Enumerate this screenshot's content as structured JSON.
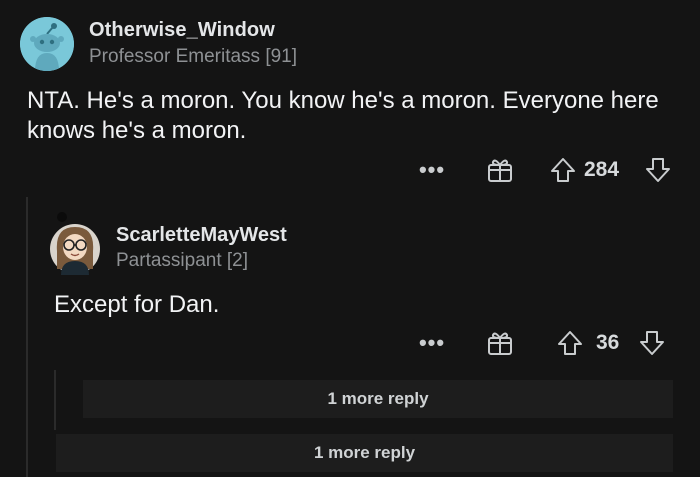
{
  "comment": {
    "author": "Otherwise_Window",
    "flair": "Professor Emeritass [91]",
    "body": "NTA. He's a moron. You know he's a moron. Everyone here knows he's a moron.",
    "more_icon": "ellipsis-icon",
    "award_icon": "gift-icon",
    "upvote_icon": "arrow-up-icon",
    "downvote_icon": "arrow-down-icon",
    "dots": "•••",
    "score": "284"
  },
  "reply": {
    "author": "ScarletteMayWest",
    "flair": "Partassipant [2]",
    "body": "Except for Dan.",
    "dots": "•••",
    "score": "36"
  },
  "more_replies": [
    {
      "label": "1 more reply"
    },
    {
      "label": "1 more reply"
    }
  ],
  "colors": {
    "background": "#141414",
    "row": "#1d1d1d",
    "avatar_top": "#7ac8d9"
  }
}
